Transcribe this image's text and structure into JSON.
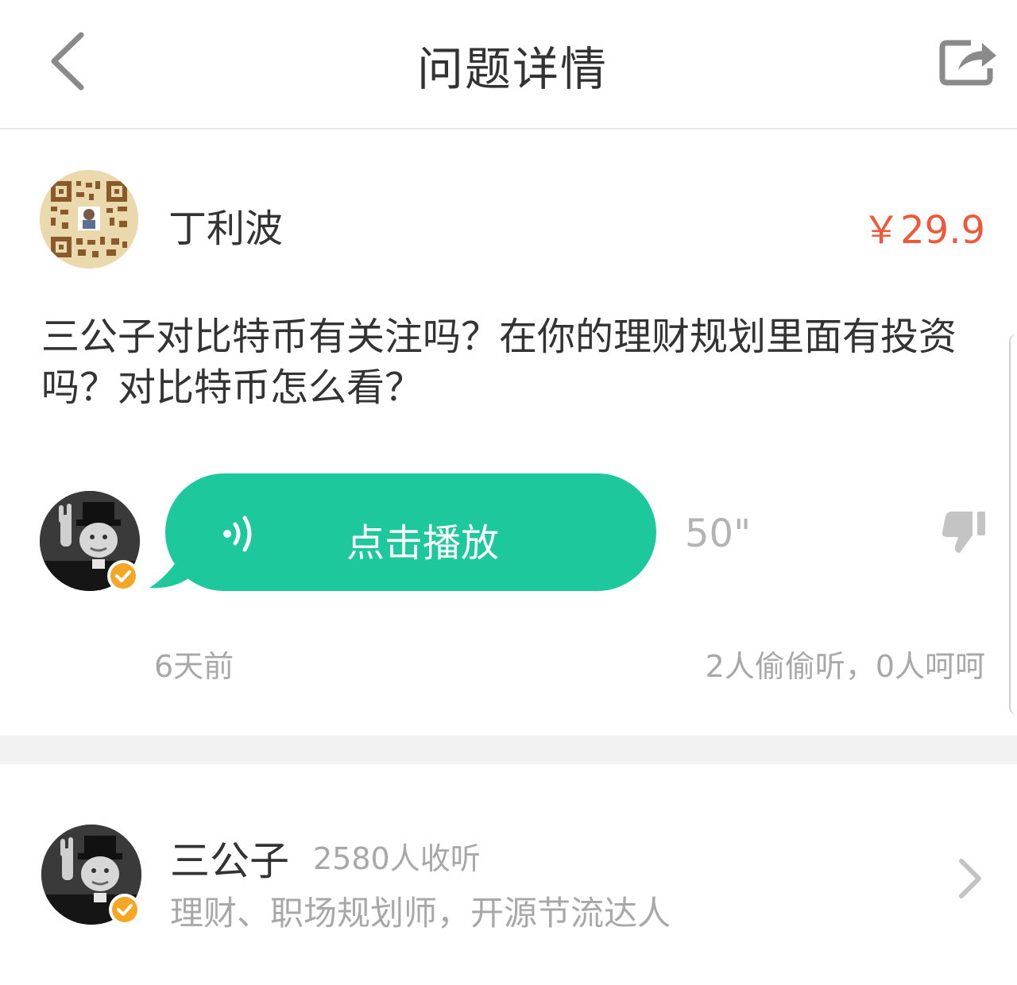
{
  "header": {
    "title": "问题详情",
    "back_icon": "chevron-left-icon",
    "share_icon": "share-icon"
  },
  "asker": {
    "name": "丁利波",
    "price": "￥29.9"
  },
  "question": {
    "text": "三公子对比特币有关注吗？在你的理财规划里面有投资吗？对比特币怎么看？"
  },
  "answer": {
    "play_label": "点击播放",
    "duration": "50\"",
    "time_ago": "6天前",
    "stats": "2人偷偷听，0人呵呵",
    "accent": "#1cc89c"
  },
  "expert": {
    "name": "三公子",
    "listeners": "2580人收听",
    "bio": "理财、职场规划师，开源节流达人"
  },
  "colors": {
    "price": "#f0583a",
    "badge": "#f5a623"
  }
}
